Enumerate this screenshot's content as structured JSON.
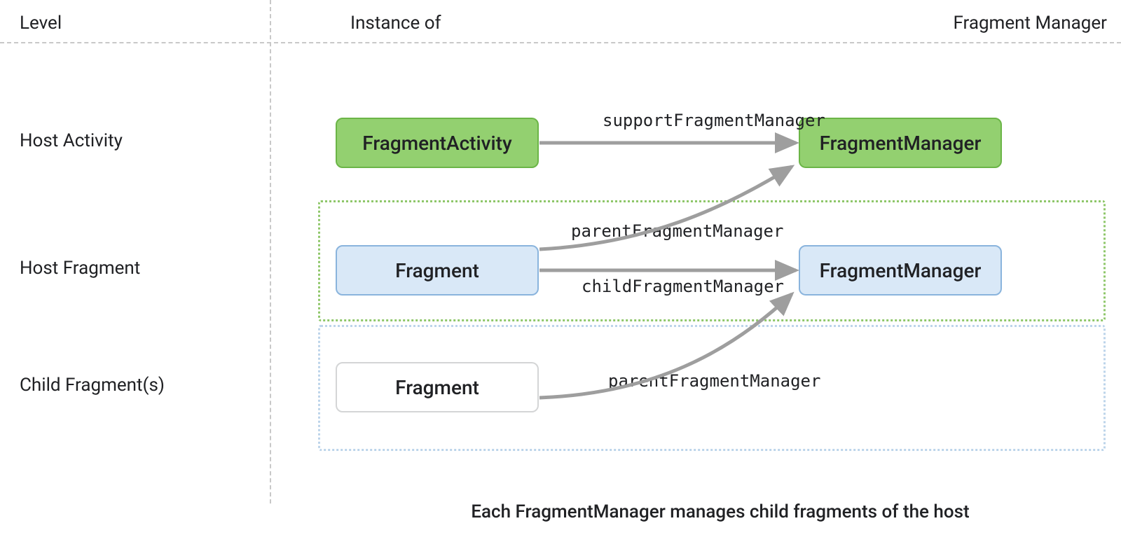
{
  "header": {
    "level": "Level",
    "instance": "Instance of",
    "fm": "Fragment Manager"
  },
  "levels": {
    "hostActivity": "Host Activity",
    "hostFragment": "Host Fragment",
    "childFragments": "Child Fragment(s)"
  },
  "boxes": {
    "fragmentActivity": "FragmentActivity",
    "fragmentManagerTop": "FragmentManager",
    "fragmentMid": "Fragment",
    "fragmentManagerMid": "FragmentManager",
    "fragmentBot": "Fragment"
  },
  "edges": {
    "supportFM": "supportFragmentManager",
    "parentFM1": "parentFragmentManager",
    "childFM": "childFragmentManager",
    "parentFM2": "parentFragmentManager"
  },
  "caption": "Each FragmentManager manages child fragments of the host"
}
